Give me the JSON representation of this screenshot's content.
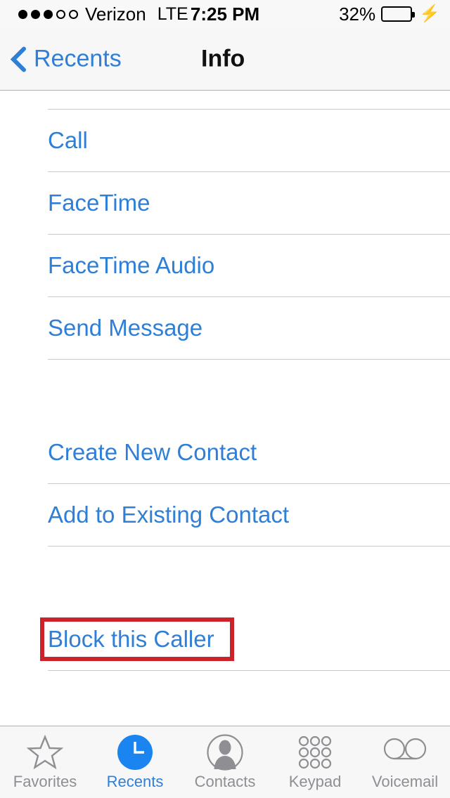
{
  "status_bar": {
    "signal_dots_total": 5,
    "signal_dots_filled": 3,
    "carrier": "Verizon",
    "network": "LTE",
    "time": "7:25 PM",
    "battery_percent": "32%",
    "battery_level": 32,
    "battery_color": "#4cd764",
    "charging": true
  },
  "nav": {
    "back_label": "Recents",
    "title": "Info"
  },
  "colors": {
    "accent_blue": "#2f7fd6",
    "highlight_red": "#cc2229",
    "separator": "#c8c7cc",
    "inactive_gray": "#8e8e93"
  },
  "content": {
    "groups": [
      {
        "rows": [
          {
            "label": "Call"
          },
          {
            "label": "FaceTime"
          },
          {
            "label": "FaceTime Audio"
          },
          {
            "label": "Send Message"
          }
        ]
      },
      {
        "rows": [
          {
            "label": "Create New Contact"
          },
          {
            "label": "Add to Existing Contact"
          }
        ]
      },
      {
        "rows": [
          {
            "label": "Block this Caller",
            "highlighted": true
          }
        ]
      }
    ]
  },
  "tab_bar": {
    "items": [
      {
        "label": "Favorites",
        "icon": "star-icon",
        "active": false
      },
      {
        "label": "Recents",
        "icon": "clock-icon",
        "active": true
      },
      {
        "label": "Contacts",
        "icon": "person-icon",
        "active": false
      },
      {
        "label": "Keypad",
        "icon": "keypad-icon",
        "active": false
      },
      {
        "label": "Voicemail",
        "icon": "voicemail-icon",
        "active": false
      }
    ]
  }
}
